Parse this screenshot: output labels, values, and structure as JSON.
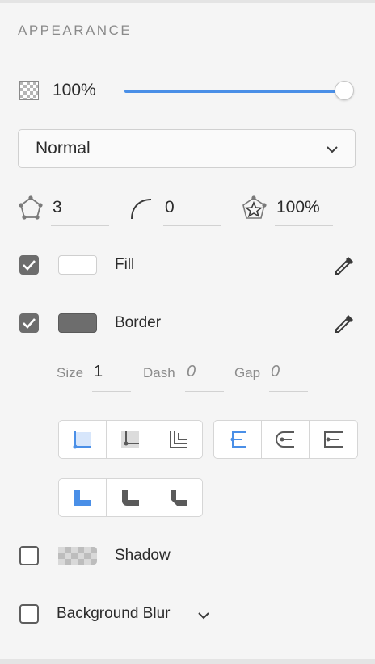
{
  "section": {
    "title": "APPEARANCE"
  },
  "opacity": {
    "value": "100%",
    "slider_level": 1.0
  },
  "blend_mode": {
    "selected": "Normal"
  },
  "polygon": {
    "sides": "3",
    "corner_radius": "0",
    "star_ratio": "100%"
  },
  "fill": {
    "label": "Fill",
    "checked": true,
    "color": "#ffffff"
  },
  "border": {
    "label": "Border",
    "checked": true,
    "color": "#6d6d6d",
    "size_label": "Size",
    "size_value": "1",
    "dash_label": "Dash",
    "dash_value": "0",
    "gap_label": "Gap",
    "gap_value": "0"
  },
  "shadow": {
    "label": "Shadow",
    "checked": false
  },
  "background_blur": {
    "label": "Background Blur",
    "checked": false
  },
  "colors": {
    "accent": "#4a8fe7",
    "icon": "#6a6a6a"
  }
}
